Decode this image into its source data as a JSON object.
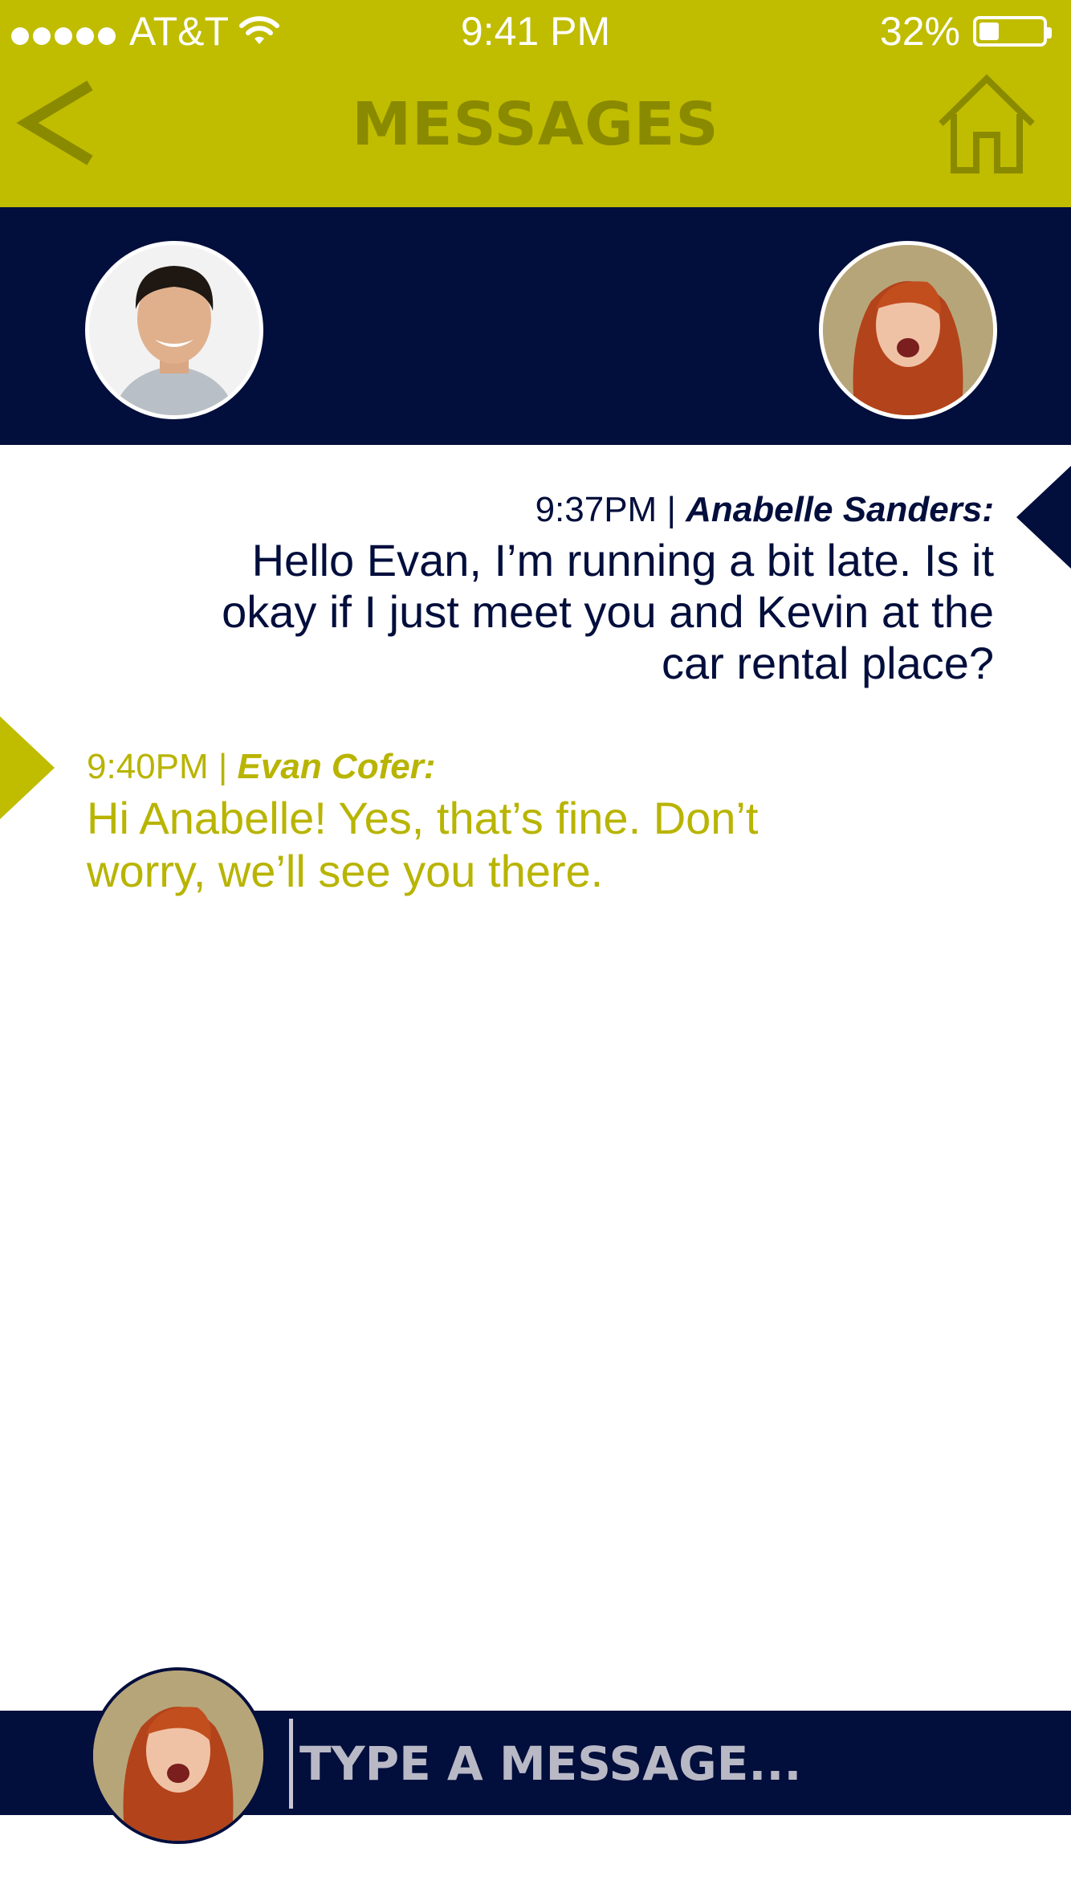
{
  "status_bar": {
    "carrier": "AT&T",
    "signal_dots": 5,
    "time": "9:41 PM",
    "battery_percent": "32%",
    "battery_level": 0.32,
    "wifi_icon": "wifi-icon"
  },
  "header": {
    "title": "MESSAGES",
    "back_icon": "chevron-left-icon",
    "home_icon": "home-icon",
    "bg_color": "#c0bc00",
    "title_color": "#8a8a00"
  },
  "participants": {
    "bg_color": "#020e3c",
    "left_avatar": "avatar-evan",
    "right_avatar": "avatar-anabelle"
  },
  "messages": [
    {
      "time": "9:37PM",
      "sender": "Anabelle Sanders:",
      "text": "Hello Evan, I’m running a bit late. Is it okay if I just meet you and Kevin at the car rental place?",
      "color": "#020e3c"
    },
    {
      "time": "9:40PM",
      "sender": "Evan Cofer:",
      "text": "Hi Anabelle! Yes, that’s fine. Don’t worry, we’ll see you there.",
      "color": "#b8b400"
    }
  ],
  "composer": {
    "placeholder": "TYPE A MESSAGE...",
    "value": ""
  }
}
